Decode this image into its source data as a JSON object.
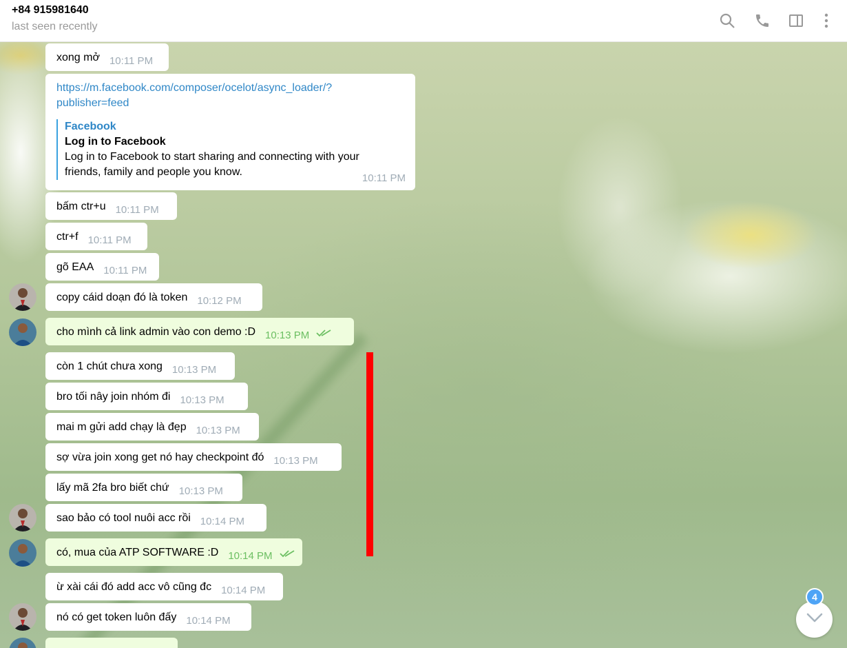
{
  "header": {
    "name": "+84 915981640",
    "status": "last seen recently",
    "icons": [
      "search-icon",
      "phone-icon",
      "sidebar-icon",
      "more-vertical-icon"
    ]
  },
  "messages": [
    {
      "text": "xong mở",
      "time": "10:11 PM"
    },
    {
      "link": {
        "url": "https://m.facebook.com/composer/ocelot/async_loader/?publisher=feed",
        "url_line1": "https://m.facebook.com/composer/ocelot/async_loader/?",
        "url_line2": "publisher=feed",
        "site": "Facebook",
        "title": "Log in to Facebook",
        "desc_line1": "Log in to Facebook to start sharing and connecting with your",
        "desc_line2": "friends, family and people you know.",
        "time": "10:11 PM"
      }
    },
    {
      "text": "bấm ctr+u",
      "time": "10:11 PM"
    },
    {
      "text": "ctr+f",
      "time": "10:11 PM"
    },
    {
      "text": "gõ EAA",
      "time": "10:11 PM"
    },
    {
      "text": "copy cáid doạn đó là token",
      "time": "10:12 PM"
    },
    {
      "text": "cho mình cả link admin vào con demo :D",
      "time": "10:13 PM",
      "outgoing": true
    },
    {
      "text": "còn 1 chút chưa xong",
      "time": "10:13 PM"
    },
    {
      "text": "bro tối nây join nhóm đi",
      "time": "10:13 PM"
    },
    {
      "text": "mai m gửi add chạy là đẹp",
      "time": "10:13 PM"
    },
    {
      "text": "sợ vừa join xong get nó hay checkpoint đó",
      "time": "10:13 PM"
    },
    {
      "text": "lấy mã 2fa bro biết chứ",
      "time": "10:13 PM"
    },
    {
      "text": "sao bảo có tool nuôi acc rồi",
      "time": "10:14 PM"
    },
    {
      "text": "có, mua của ATP SOFTWARE :D",
      "time": "10:14 PM",
      "outgoing": true
    },
    {
      "text": "ừ xài cái đó add acc vô cũng đc",
      "time": "10:14 PM"
    },
    {
      "text": "nó có get token luôn đấy",
      "time": "10:14 PM"
    }
  ],
  "unread_count": "4",
  "colors": {
    "outgoing_bg": "#effdde",
    "link": "#2f87c7",
    "highlight": "#ff0000",
    "badge": "#4ea4f6"
  }
}
